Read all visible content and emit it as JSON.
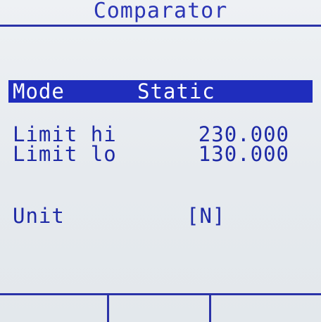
{
  "screen": {
    "title": "Comparator"
  },
  "mode": {
    "label": "Mode",
    "value": "Static"
  },
  "limits": {
    "hi_label": "Limit hi",
    "hi_value": "230.000",
    "lo_label": "Limit lo",
    "lo_value": "130.000"
  },
  "unit": {
    "label": "Unit",
    "value": "[N]"
  },
  "softkeys": [
    "",
    "",
    ""
  ],
  "colors": {
    "lcd_background": "#e9edf0",
    "text": "#1e2aa6",
    "highlight": "#1f2dbd",
    "highlight_text": "#ffffff"
  }
}
